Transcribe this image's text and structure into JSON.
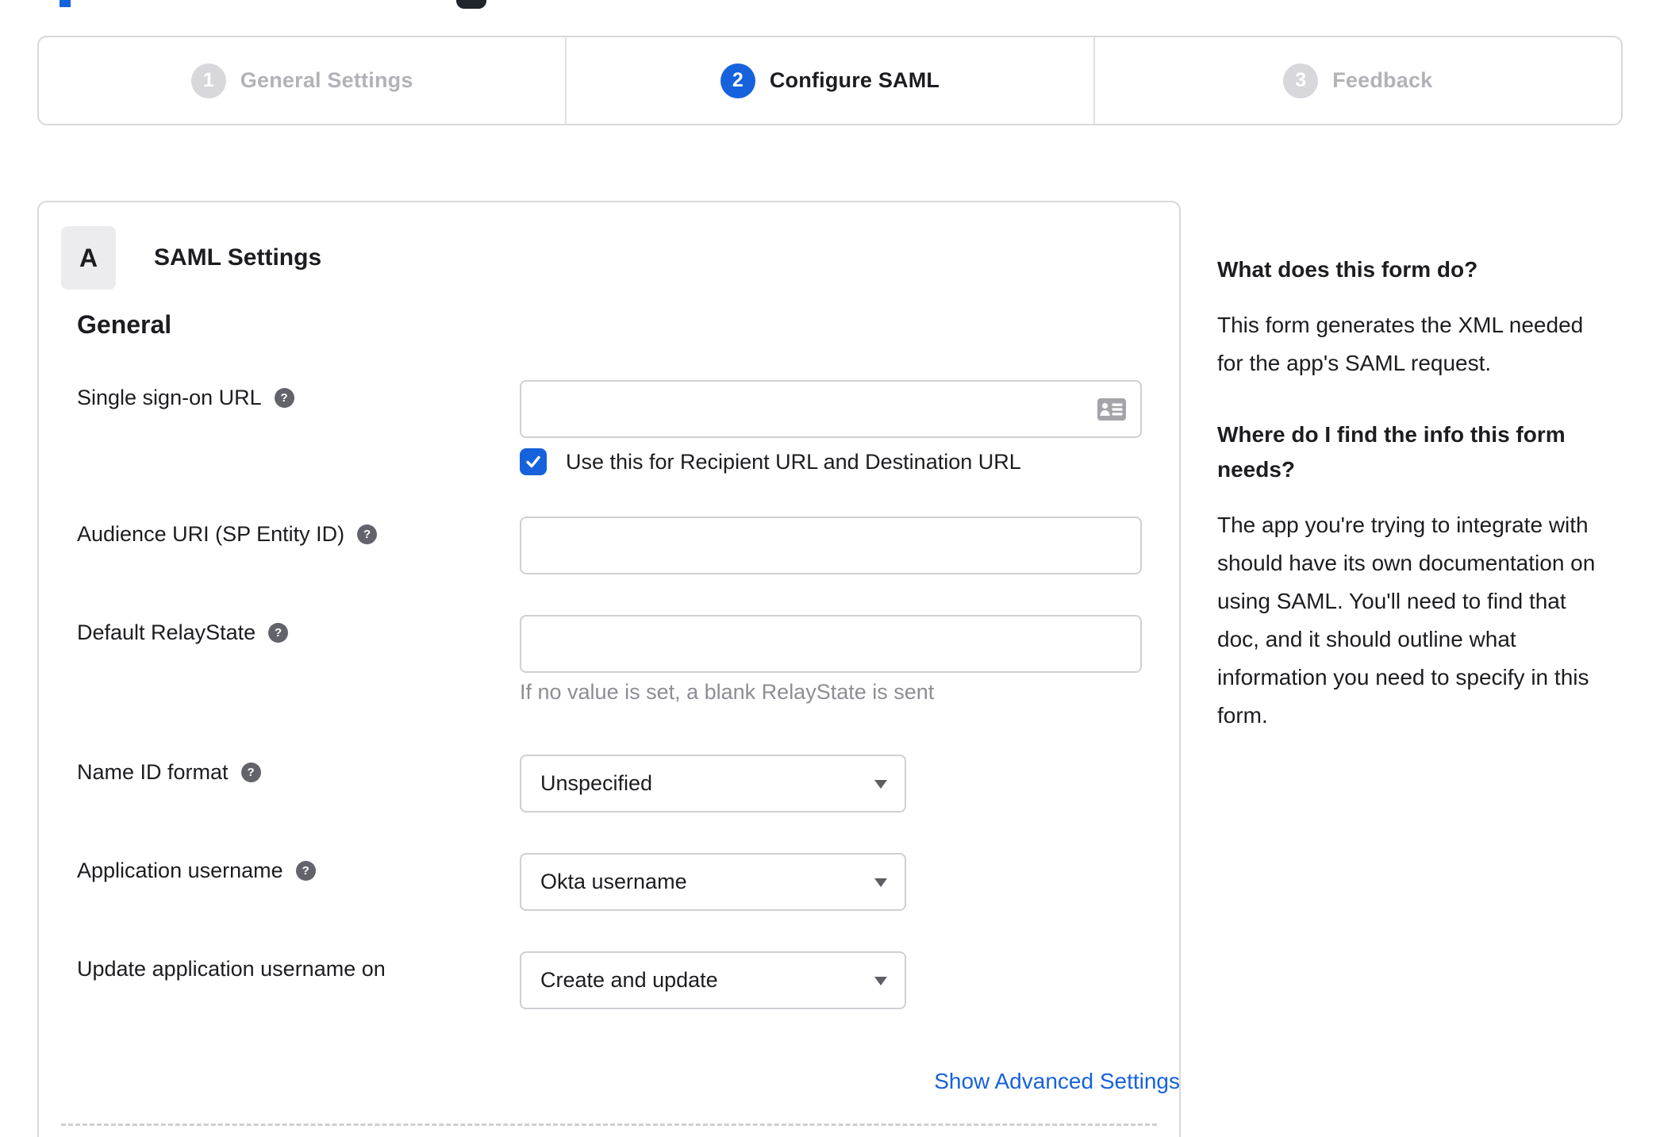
{
  "colors": {
    "accent": "#1662dd",
    "link": "#1662dd",
    "inactive_gray": "#d7d7dc"
  },
  "stepper": {
    "steps": [
      {
        "number": "1",
        "label": "General Settings",
        "state": "inactive"
      },
      {
        "number": "2",
        "label": "Configure SAML",
        "state": "active"
      },
      {
        "number": "3",
        "label": "Feedback",
        "state": "inactive"
      }
    ]
  },
  "panel": {
    "badge": "A",
    "title": "SAML Settings",
    "section_heading": "General",
    "fields": {
      "sso": {
        "label": "Single sign-on URL",
        "help_icon": "?",
        "value": "",
        "checkbox": {
          "checked": true,
          "label": "Use this for Recipient URL and Destination URL"
        }
      },
      "audience": {
        "label": "Audience URI (SP Entity ID)",
        "help_icon": "?",
        "value": ""
      },
      "relay": {
        "label": "Default RelayState",
        "help_icon": "?",
        "value": "",
        "hint": "If no value is set, a blank RelayState is sent"
      },
      "name_id": {
        "label": "Name ID format",
        "help_icon": "?",
        "value": "Unspecified"
      },
      "app_username": {
        "label": "Application username",
        "help_icon": "?",
        "value": "Okta username"
      },
      "update_username": {
        "label": "Update application username on",
        "value": "Create and update"
      }
    },
    "advanced_link": "Show Advanced Settings"
  },
  "sidebar": {
    "heading1": "What does this form do?",
    "para1": "This form generates the XML needed\nfor the app's SAML request.",
    "heading2": "Where do I find the info this form\nneeds?",
    "para2": "The app you're trying to integrate with\nshould have its own documentation on\nusing SAML. You'll need to find that\ndoc, and it should outline what\ninformation you need to specify in this\nform."
  }
}
